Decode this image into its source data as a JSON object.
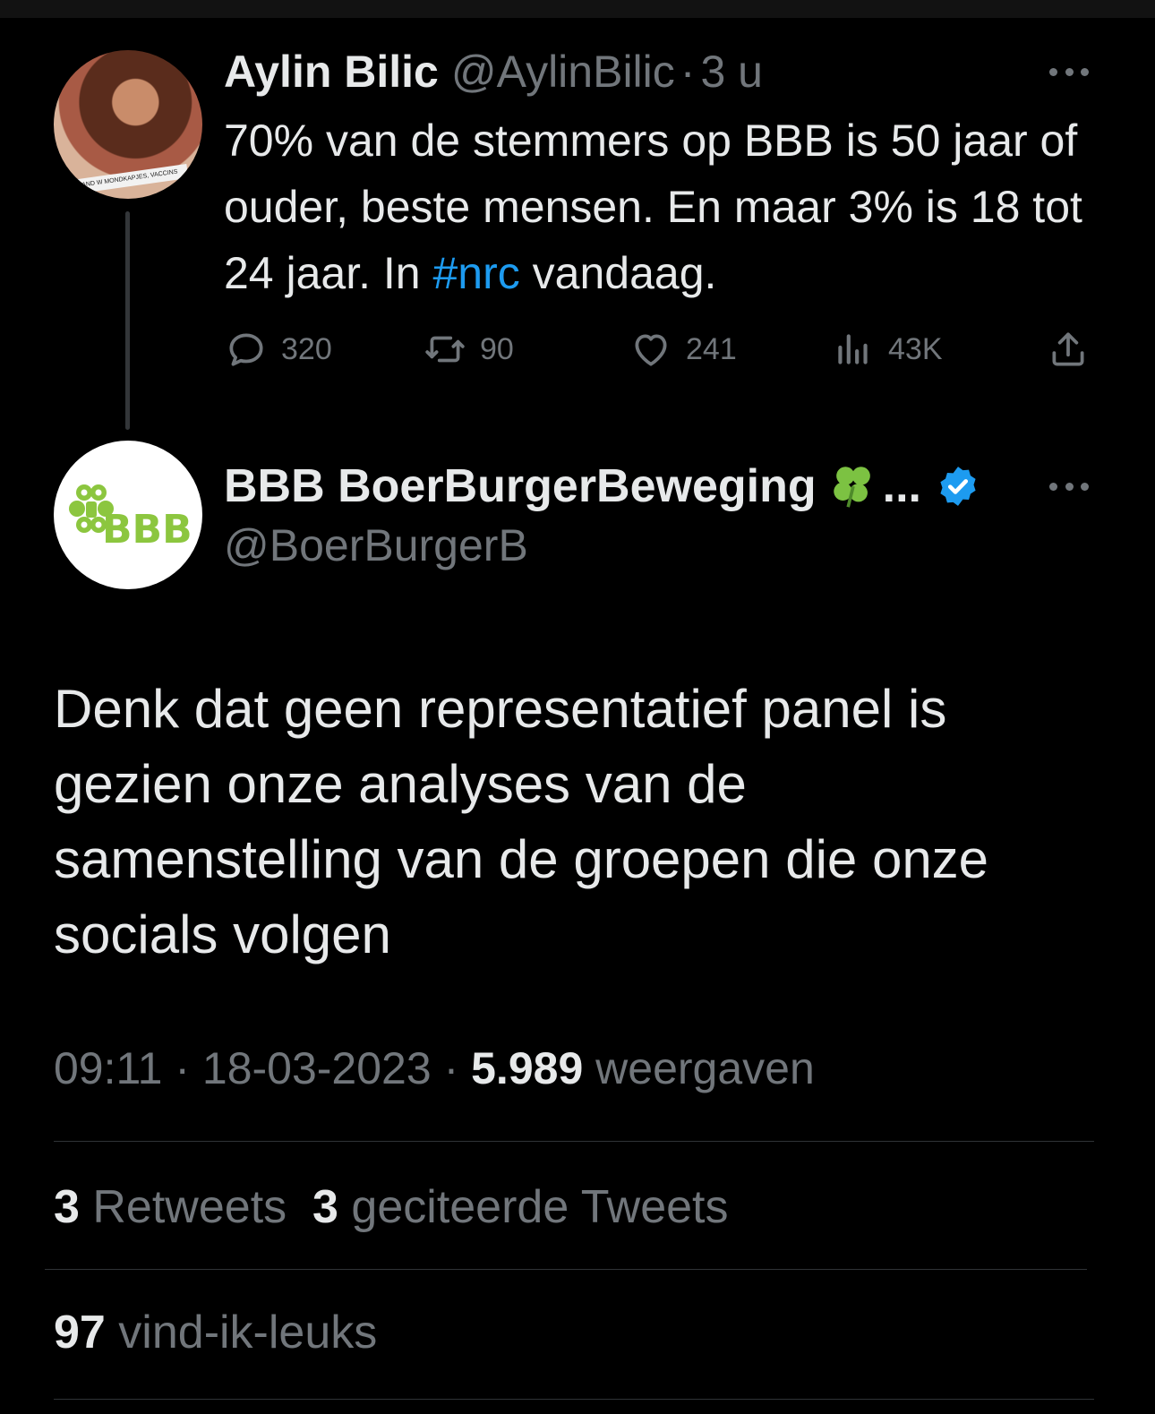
{
  "parent_tweet": {
    "author_name": "Aylin Bilic",
    "handle": "@AylinBilic",
    "separator": "·",
    "time": "3 u",
    "avatar_caption": "AND W MONDKAPJES, VACCINS",
    "text_before_hashtag": "70% van de stemmers op BBB is 50 jaar of ouder, beste mensen. En maar 3% is 18 tot 24 jaar. In ",
    "hashtag": "#nrc",
    "text_after_hashtag": " vandaag.",
    "replies": "320",
    "retweets": "90",
    "likes": "241",
    "views": "43K",
    "icons": [
      "reply-icon",
      "retweet-icon",
      "like-icon",
      "views-icon",
      "share-icon",
      "more-icon"
    ]
  },
  "main_tweet": {
    "author_name": "BBB BoerBurgerBeweging",
    "name_emoji": "clover-icon",
    "ellipsis": "...",
    "verified": "verified-badge-icon",
    "handle": "@BoerBurgerB",
    "avatar_logo_text": "BBB",
    "text": "Denk dat geen representatief panel is gezien onze analyses van de samenstelling van de groepen die onze socials volgen",
    "time": "09:11",
    "separator": "·",
    "date": "18-03-2023",
    "views_count": "5.989",
    "views_label": "weergaven",
    "retweets_count": "3",
    "retweets_label": "Retweets",
    "quotes_count": "3",
    "quotes_label": "geciteerde Tweets",
    "likes_count": "97",
    "likes_label": "vind-ik-leuks"
  },
  "colors": {
    "background": "#000000",
    "text": "#e7e9ea",
    "secondary_text": "#71767b",
    "link": "#1d9bf0",
    "brand_green": "#8cc63f",
    "verified": "#1d9bf0"
  }
}
